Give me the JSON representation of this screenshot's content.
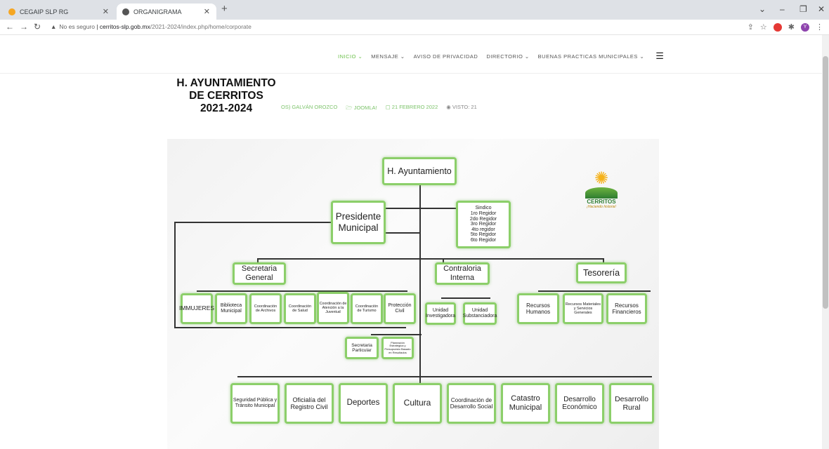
{
  "browser": {
    "tabs": [
      {
        "title": "CEGAIP SLP RG",
        "favicon_color": "#f5a623"
      },
      {
        "title": "ORGANIGRAMA",
        "favicon_color": "#555555"
      }
    ],
    "address": {
      "security_label": "No es seguro",
      "host": "cerritos-slp.gob.mx",
      "path": "/2021-2024/index.php/home/corporate"
    },
    "profile_initial": "Y"
  },
  "nav": {
    "items": [
      "INICIO ⌄",
      "MENSAJE ⌄",
      "AVISO DE PRIVACIDAD",
      "DIRECTORIO ⌄",
      "BUENAS PRACTICAS MUNICIPALES ⌄"
    ]
  },
  "site": {
    "title_lines": [
      "H. AYUNTAMIENTO",
      "DE CERRITOS",
      "2021-2024"
    ]
  },
  "article_meta": {
    "author": "OS) GALVÁN OROZCO",
    "category": "JOOMLA!",
    "date": "21 FEBRERO 2022",
    "views": "VISTO: 21"
  },
  "org": {
    "emblem_name": "CERRITOS",
    "emblem_slogan": "¡Haciendo historia!",
    "root": "H. Ayuntamiento",
    "president": "Presidente Municipal",
    "cabildo": [
      "Sindico",
      "1ro Regidor",
      "2do Regidor",
      "3ro Regidor",
      "4to regidor",
      "5to Regidor",
      "6to Regidor"
    ],
    "secretaria": "Secretaria General",
    "contraloria": "Contraloria Interna",
    "tesoreria": "Tesorería",
    "sec_units": [
      "IMMUJERES",
      "Biblioteca Municipal",
      "Coordinación de Archivos",
      "Coordinación de Salud",
      "Coordinación de Atención a la Juventud",
      "Coordinación de Turismo",
      "Protección Civil"
    ],
    "contra_units": [
      "Unidad Investigadora",
      "Unidad Substanciadora"
    ],
    "teso_units": [
      "Recursos Humanos",
      "Recursos Materiales y Servicios Generales",
      "Recursos Financieros"
    ],
    "pres_units": [
      "Secretaria Particular",
      "Planeación Estratégica y Presupuesto Basado en Resultados"
    ],
    "directions": [
      "Seguridad Pública y Tránsito Municipal",
      "Oficialía del Registro Civil",
      "Deportes",
      "Cultura",
      "Coordinación de Desarrollo Social",
      "Catastro Municipal",
      "Desarrollo Económico",
      "Desarrollo Rural"
    ]
  }
}
